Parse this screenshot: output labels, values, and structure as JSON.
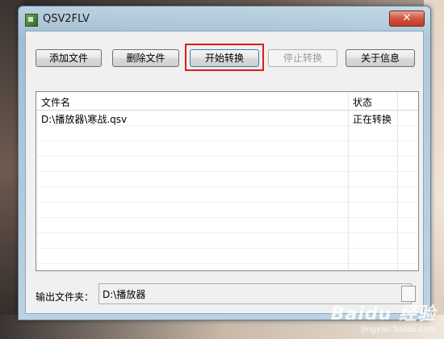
{
  "window": {
    "title": "QSV2FLV",
    "close_glyph": "✕"
  },
  "toolbar": {
    "add_file": "添加文件",
    "delete_file": "删除文件",
    "start_convert": "开始转换",
    "stop_convert": "停止转换",
    "about": "关于信息"
  },
  "list": {
    "columns": [
      "文件名",
      "状态"
    ],
    "rows": [
      {
        "filename": "D:\\播放器\\寒战.qsv",
        "status": "正在转换"
      }
    ]
  },
  "output": {
    "label": "输出文件夹：",
    "value": "D:\\播放器"
  },
  "watermark": {
    "main": "Baidu 经验",
    "sub": "jingyan.baidu.com"
  },
  "colors": {
    "highlight": "#e0191b",
    "close_button": "#c23a25"
  },
  "icons": {
    "app": "app-icon",
    "close": "close-icon"
  }
}
